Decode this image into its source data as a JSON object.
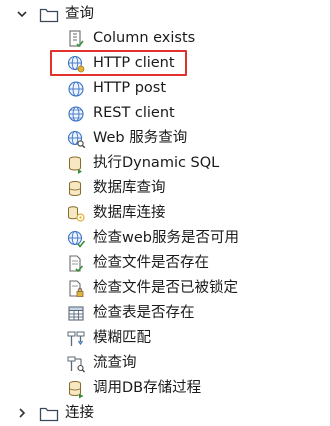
{
  "tree": {
    "root_expanded": {
      "label": "查询",
      "icon": "folder-icon",
      "expander": "chevron-down-icon"
    },
    "children": [
      {
        "label": "Column exists",
        "icon": "column-exists-icon"
      },
      {
        "label": "HTTP client",
        "icon": "http-client-icon"
      },
      {
        "label": "HTTP post",
        "icon": "http-post-icon"
      },
      {
        "label": "REST client",
        "icon": "rest-client-icon"
      },
      {
        "label": "Web 服务查询",
        "icon": "web-service-lookup-icon"
      },
      {
        "label": "执行Dynamic SQL",
        "icon": "dynamic-sql-icon"
      },
      {
        "label": "数据库查询",
        "icon": "database-lookup-icon"
      },
      {
        "label": "数据库连接",
        "icon": "database-join-icon"
      },
      {
        "label": "检查web服务是否可用",
        "icon": "web-service-available-icon"
      },
      {
        "label": "检查文件是否存在",
        "icon": "file-exists-icon"
      },
      {
        "label": "检查文件是否已被锁定",
        "icon": "file-locked-icon"
      },
      {
        "label": "检查表是否存在",
        "icon": "table-exists-icon"
      },
      {
        "label": "模糊匹配",
        "icon": "fuzzy-match-icon"
      },
      {
        "label": "流查询",
        "icon": "stream-lookup-icon"
      },
      {
        "label": "调用DB存储过程",
        "icon": "db-procedure-icon"
      }
    ],
    "root_collapsed": {
      "label": "连接",
      "icon": "folder-icon",
      "expander": "chevron-right-icon"
    },
    "highlighted_item": "HTTP client"
  },
  "colors": {
    "highlight_border": "#e0312f",
    "folder_stroke": "#3a4a5c",
    "globe_blue": "#3b73c6",
    "db_yellow": "#e3b23c",
    "doc_green": "#3a8f3a"
  }
}
